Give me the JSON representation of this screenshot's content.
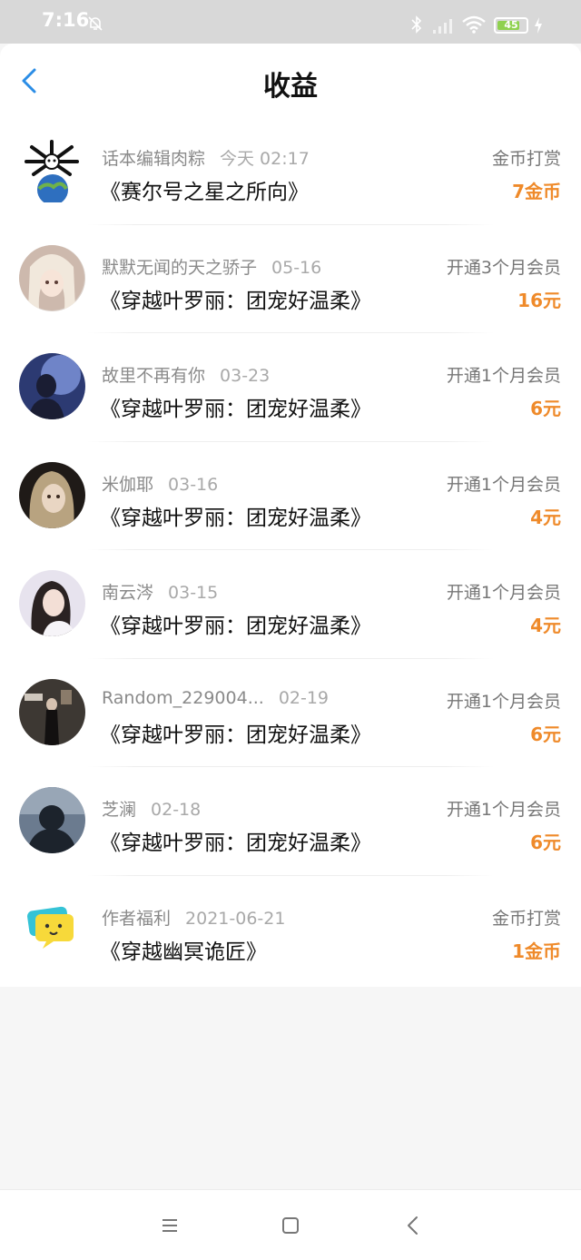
{
  "status_bar": {
    "time": "7:16",
    "battery": "45"
  },
  "header": {
    "title": "收益"
  },
  "items": [
    {
      "name": "话本编辑肉粽",
      "date": "今天 02:17",
      "book": "《赛尔号之星之所向》",
      "type": "金币打赏",
      "amount": "7金币"
    },
    {
      "name": "默默无闻的天之骄子",
      "date": "05-16",
      "book": "《穿越叶罗丽：团宠好温柔》",
      "type": "开通3个月会员",
      "amount": "16元"
    },
    {
      "name": "故里不再有你",
      "date": "03-23",
      "book": "《穿越叶罗丽：团宠好温柔》",
      "type": "开通1个月会员",
      "amount": "6元"
    },
    {
      "name": "米伽耶",
      "date": "03-16",
      "book": "《穿越叶罗丽：团宠好温柔》",
      "type": "开通1个月会员",
      "amount": "4元"
    },
    {
      "name": "南云涔",
      "date": "03-15",
      "book": "《穿越叶罗丽：团宠好温柔》",
      "type": "开通1个月会员",
      "amount": "4元"
    },
    {
      "name": "Random_229004...",
      "date": "02-19",
      "book": "《穿越叶罗丽：团宠好温柔》",
      "type": "开通1个月会员",
      "amount": "6元"
    },
    {
      "name": "芝澜",
      "date": "02-18",
      "book": "《穿越叶罗丽：团宠好温柔》",
      "type": "开通1个月会员",
      "amount": "6元"
    },
    {
      "name": "作者福利",
      "date": "2021-06-21",
      "book": "《穿越幽冥诡匠》",
      "type": "金币打赏",
      "amount": "1金币"
    }
  ]
}
